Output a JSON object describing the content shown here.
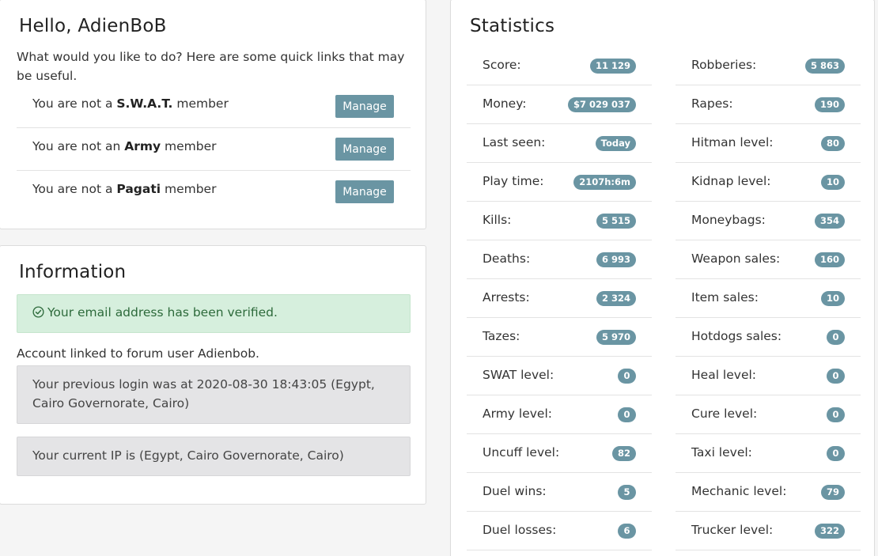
{
  "hello": {
    "title": "Hello, AdienBoB",
    "intro": "What would you like to do? Here are some quick links that may be useful.",
    "memberships": [
      {
        "prefix": "You are not a ",
        "group": "S.W.A.T.",
        "suffix": " member",
        "button": "Manage"
      },
      {
        "prefix": "You are not an ",
        "group": "Army",
        "suffix": " member",
        "button": "Manage"
      },
      {
        "prefix": "You are not a ",
        "group": "Pagati",
        "suffix": " member",
        "button": "Manage"
      }
    ]
  },
  "information": {
    "title": "Information",
    "verified_alert": "Your email address has been verified.",
    "linked_account": "Account linked to forum user Adienbob.",
    "previous_login": "Your previous login was at 2020-08-30 18:43:05 (Egypt, Cairo Governorate, Cairo)",
    "current_ip": "Your current IP is (Egypt, Cairo Governorate, Cairo)"
  },
  "statistics": {
    "title": "Statistics",
    "left": [
      {
        "label": "Score:",
        "value": "11 129"
      },
      {
        "label": "Money:",
        "value": "$7 029 037"
      },
      {
        "label": "Last seen:",
        "value": "Today"
      },
      {
        "label": "Play time:",
        "value": "2107h:6m"
      },
      {
        "label": "Kills:",
        "value": "5 515"
      },
      {
        "label": "Deaths:",
        "value": "6 993"
      },
      {
        "label": "Arrests:",
        "value": "2 324"
      },
      {
        "label": "Tazes:",
        "value": "5 970"
      },
      {
        "label": "SWAT level:",
        "value": "0"
      },
      {
        "label": "Army level:",
        "value": "0"
      },
      {
        "label": "Uncuff level:",
        "value": "82"
      },
      {
        "label": "Duel wins:",
        "value": "5"
      },
      {
        "label": "Duel losses:",
        "value": "6"
      }
    ],
    "right": [
      {
        "label": "Robberies:",
        "value": "5 863"
      },
      {
        "label": "Rapes:",
        "value": "190"
      },
      {
        "label": "Hitman level:",
        "value": "80"
      },
      {
        "label": "Kidnap level:",
        "value": "10"
      },
      {
        "label": "Moneybags:",
        "value": "354"
      },
      {
        "label": "Weapon sales:",
        "value": "160"
      },
      {
        "label": "Item sales:",
        "value": "10"
      },
      {
        "label": "Hotdogs sales:",
        "value": "0"
      },
      {
        "label": "Heal level:",
        "value": "0"
      },
      {
        "label": "Cure level:",
        "value": "0"
      },
      {
        "label": "Taxi level:",
        "value": "0"
      },
      {
        "label": "Mechanic level:",
        "value": "79"
      },
      {
        "label": "Trucker level:",
        "value": "322"
      }
    ]
  },
  "colors": {
    "accent": "#6a95a3",
    "success_bg": "#d6efdd",
    "success_text": "#2d6a3b",
    "well_bg": "#e4e4e6"
  },
  "icons": {
    "verified": "check-circle-icon"
  }
}
